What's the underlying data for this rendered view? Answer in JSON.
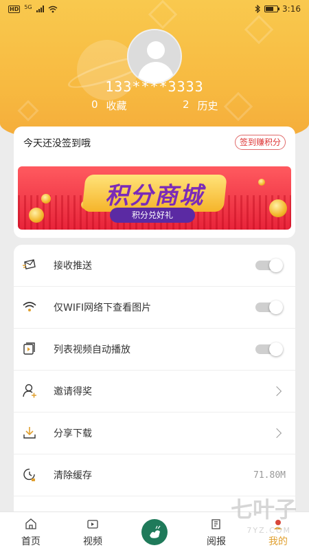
{
  "status": {
    "time": "3:16",
    "network": "HD",
    "signal": "5G"
  },
  "profile": {
    "phone": "133****3333",
    "favorites_count": "0",
    "favorites_label": "收藏",
    "history_count": "2",
    "history_label": "历史"
  },
  "signin": {
    "text": "今天还没签到哦",
    "button": "签到赚积分",
    "banner_title": "积分商城",
    "banner_subtitle": "积分兑好礼"
  },
  "settings": [
    {
      "label": "接收推送",
      "type": "toggle",
      "on": false,
      "icon": "envelope-icon"
    },
    {
      "label": "仅WIFI网络下查看图片",
      "type": "toggle",
      "on": false,
      "icon": "wifi-icon"
    },
    {
      "label": "列表视频自动播放",
      "type": "toggle",
      "on": false,
      "icon": "video-play-icon"
    },
    {
      "label": "邀请得奖",
      "type": "link",
      "icon": "invite-user-icon"
    },
    {
      "label": "分享下载",
      "type": "link",
      "icon": "download-icon"
    },
    {
      "label": "清除缓存",
      "type": "value",
      "value": "71.80M",
      "icon": "clock-icon"
    }
  ],
  "tabs": [
    {
      "label": "首页",
      "icon": "home-icon"
    },
    {
      "label": "视频",
      "icon": "tv-icon"
    },
    {
      "label": "",
      "icon": "app-logo-icon"
    },
    {
      "label": "阅报",
      "icon": "book-icon"
    },
    {
      "label": "我的",
      "icon": "profile-icon",
      "active": true
    }
  ],
  "watermark": {
    "text": "七叶子",
    "sub": "7YZ.COM"
  },
  "colors": {
    "header": "#f7b940",
    "accent": "#e0a030",
    "badge_border": "#e06a6a"
  }
}
